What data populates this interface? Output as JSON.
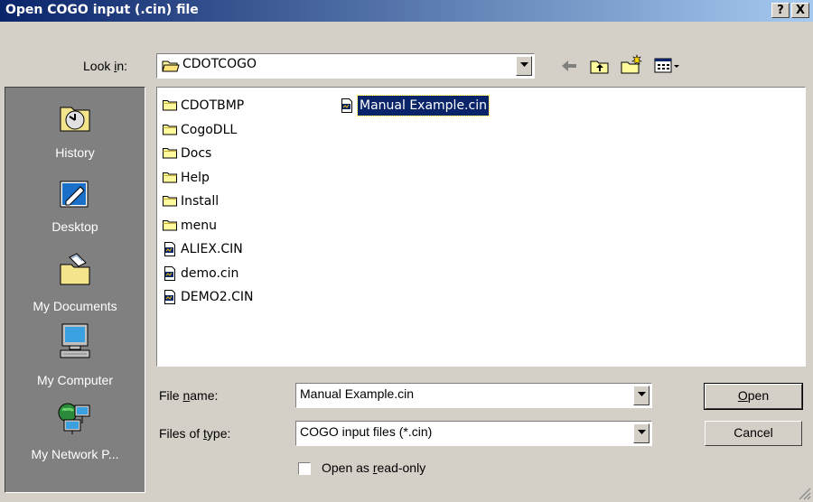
{
  "window": {
    "title": "Open COGO input (.cin) file",
    "help_label": "?",
    "close_label": "X"
  },
  "lookin": {
    "label_pre": "Look ",
    "label_ul": "i",
    "label_post": "n:",
    "value": "CDOTCOGO"
  },
  "places": [
    {
      "label": "History",
      "icon": "history-icon"
    },
    {
      "label": "Desktop",
      "icon": "desktop-icon"
    },
    {
      "label": "My Documents",
      "icon": "my-documents-icon"
    },
    {
      "label": "My Computer",
      "icon": "my-computer-icon"
    },
    {
      "label": "My Network P...",
      "icon": "my-network-places-icon"
    }
  ],
  "files": {
    "col1": [
      {
        "name": "CDOTBMP",
        "type": "folder"
      },
      {
        "name": "CogoDLL",
        "type": "folder"
      },
      {
        "name": "Docs",
        "type": "folder"
      },
      {
        "name": "Help",
        "type": "folder"
      },
      {
        "name": "Install",
        "type": "folder"
      },
      {
        "name": "menu",
        "type": "folder"
      },
      {
        "name": "ALIEX.CIN",
        "type": "cin"
      },
      {
        "name": "demo.cin",
        "type": "cin"
      },
      {
        "name": "DEMO2.CIN",
        "type": "cin"
      }
    ],
    "col2": [
      {
        "name": "Manual Example.cin",
        "type": "cin",
        "selected": true
      }
    ]
  },
  "filename": {
    "label_pre": "File ",
    "label_ul": "n",
    "label_post": "ame:",
    "value": "Manual Example.cin"
  },
  "filetype": {
    "label_pre": "Files of ",
    "label_ul": "t",
    "label_post": "ype:",
    "value": "COGO input files (*.cin)"
  },
  "readonly": {
    "label_pre": "Open as ",
    "label_ul": "r",
    "label_post": "ead-only",
    "checked": false
  },
  "buttons": {
    "open_ul": "O",
    "open_rest": "pen",
    "cancel": "Cancel"
  },
  "colors": {
    "title_start": "#0a246a",
    "title_end": "#a6caf0",
    "face": "#d4d0c8",
    "places_bg": "#808080",
    "selection": "#0a246a"
  }
}
